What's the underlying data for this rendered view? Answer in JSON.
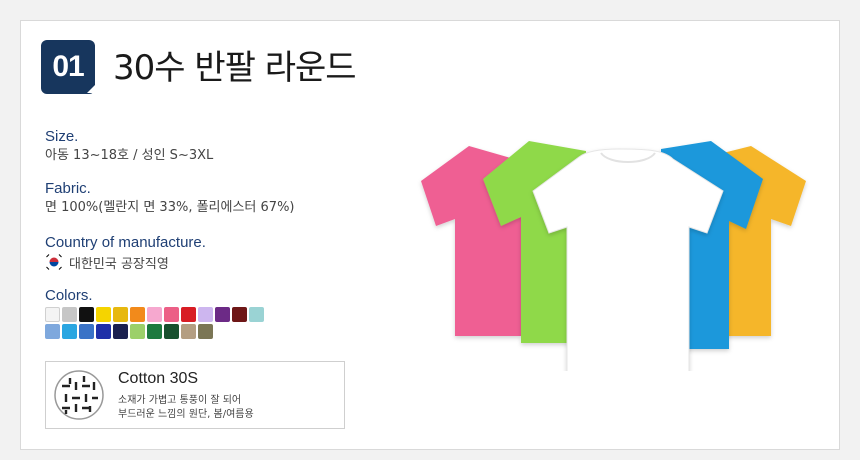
{
  "header": {
    "number": "01",
    "title": "30수 반팔 라운드"
  },
  "specs": [
    {
      "label": "Size.",
      "value": "아동 13~18호 / 성인 S~3XL"
    },
    {
      "label": "Fabric.",
      "value": "면 100%(멜란지 면 33%, 폴리에스터 67%)"
    },
    {
      "label": "Country of manufacture.",
      "value": "대한민국 공장직영",
      "icon": "korea-flag-icon"
    },
    {
      "label": "Colors."
    }
  ],
  "colors": {
    "row1": [
      "#f4f4f4",
      "#c6c6c6",
      "#111111",
      "#f5d400",
      "#e7b80f",
      "#f28a1b",
      "#f6a8cf",
      "#ec5f86",
      "#d81c24",
      "#cdb6ef",
      "#6c2a86",
      "#6e1717",
      "#9ad3d4"
    ],
    "row2": [
      "#7ea8dd",
      "#2aa6e1",
      "#3a73c7",
      "#1e2fa8",
      "#1b2050",
      "#9cd06a",
      "#1d7a3f",
      "#17502e",
      "#b49e82",
      "#7b7655"
    ]
  },
  "fabric": {
    "icon": "fabric-weave-icon",
    "title": "Cotton 30S",
    "desc_line1": "소재가 가볍고 통풍이 잘 되어",
    "desc_line2": "부드러운 느낌의 원단, 봄/여름용"
  },
  "product_image": {
    "shirt_colors": [
      "#ef5f93",
      "#8fd94a",
      "#ffffff",
      "#1a98db",
      "#f5b62c"
    ]
  }
}
